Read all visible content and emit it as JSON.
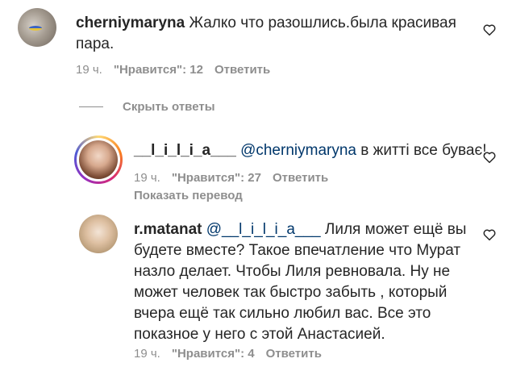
{
  "comments": [
    {
      "username": "cherniymaryna",
      "text": "Жалко что разошлись.была красивая пара.",
      "time": "19 ч.",
      "likes": "\"Нравится\": 12",
      "reply": "Ответить"
    },
    {
      "username": "__l_i_l_i_a___",
      "mention": "@cherniymaryna",
      "text": "в житті все буває!",
      "time": "19 ч.",
      "likes": "\"Нравится\": 27",
      "reply": "Ответить",
      "translate": "Показать перевод"
    },
    {
      "username": "r.matanat",
      "mention": "@__l_i_l_i_a___",
      "text": "Лиля может ещё вы будете вместе? Такое впечатление что Мурат назло делает. Чтобы Лиля ревновала. Ну не может человек так быстро забыть , который вчера ещё так сильно любил вас. Все это показное у него с этой Анастасией.",
      "time": "19 ч.",
      "likes": "\"Нравится\": 4",
      "reply": "Ответить"
    }
  ],
  "hide_replies": "Скрыть ответы",
  "icons": {
    "like": "heart-outline-icon"
  },
  "colors": {
    "mention": "#00376b",
    "meta": "#8e8e8e",
    "text": "#262626"
  }
}
